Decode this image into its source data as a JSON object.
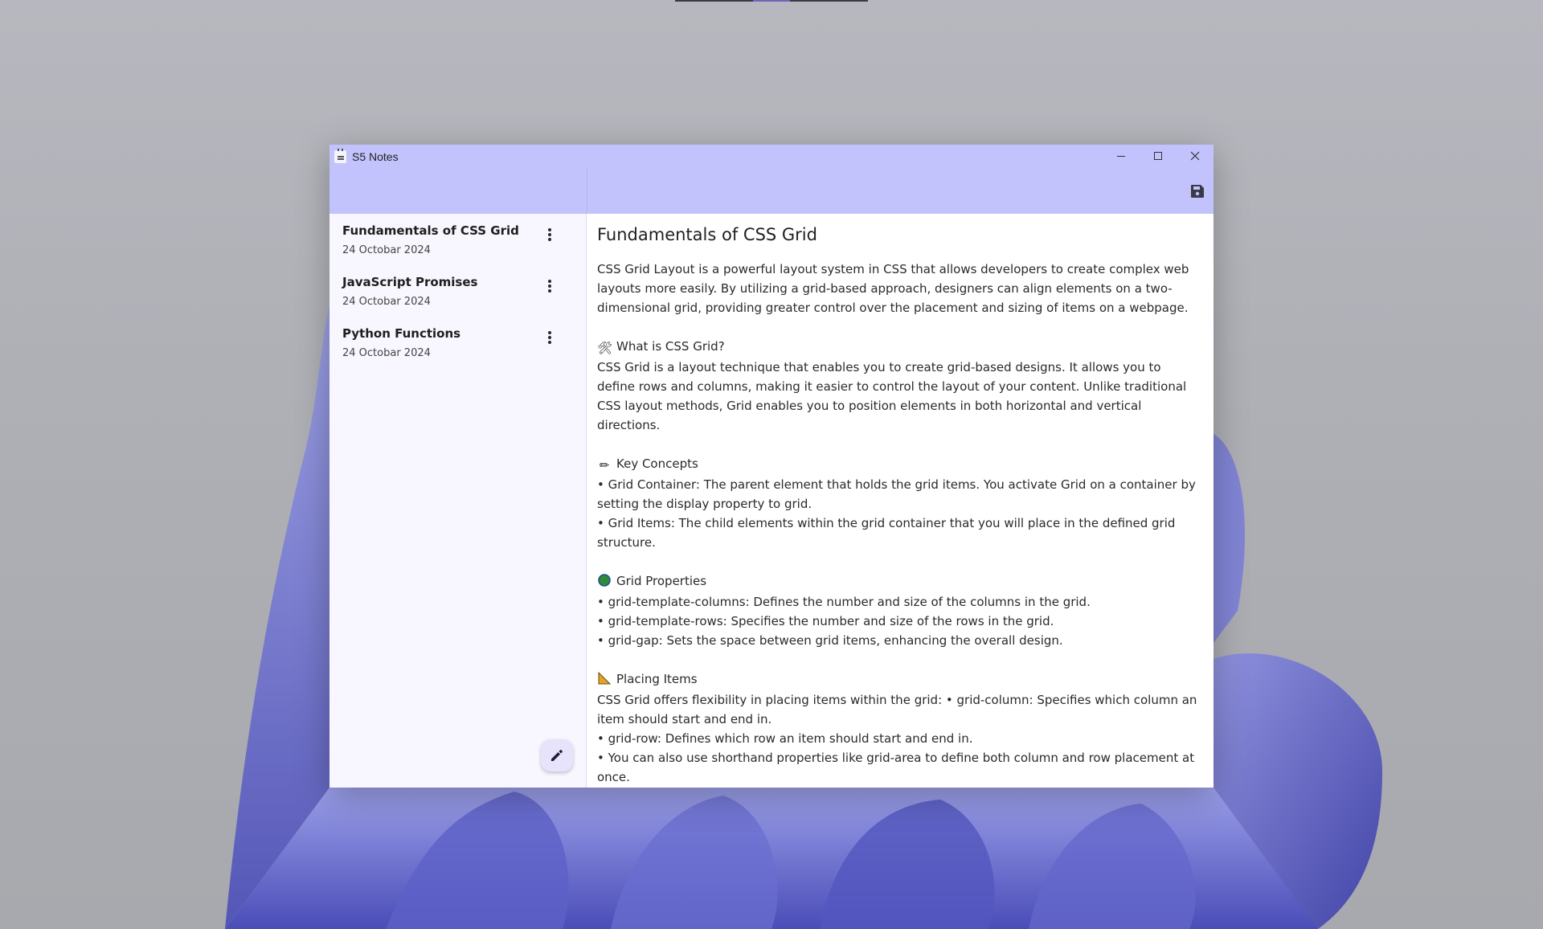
{
  "window": {
    "title": "S5 Notes"
  },
  "titlebar_buttons": {
    "minimize_icon": "minimize-icon",
    "maximize_icon": "maximize-icon",
    "close_icon": "close-icon"
  },
  "toolbar": {
    "save_icon": "save-icon"
  },
  "sidebar": {
    "notes": [
      {
        "title": "Fundamentals of CSS Grid",
        "date": "24 Octobar 2024"
      },
      {
        "title": "JavaScript Promises",
        "date": "24 Octobar 2024"
      },
      {
        "title": "Python Functions",
        "date": "24 Octobar 2024"
      }
    ],
    "new_note_icon": "pencil-icon"
  },
  "note": {
    "title": "Fundamentals of CSS Grid",
    "intro": "CSS Grid Layout is a powerful layout system in CSS that allows developers to create complex web layouts more easily. By utilizing a grid-based approach, designers can align elements on a two-dimensional grid, providing greater control over the placement and sizing of items on a webpage.",
    "section1": {
      "heading": "What is CSS Grid?",
      "text": "CSS Grid is a layout technique that enables you to create grid-based designs. It allows you to define rows and columns, making it easier to control the layout of your content. Unlike traditional CSS layout methods, Grid enables you to position elements in both horizontal and vertical directions."
    },
    "section2": {
      "heading": "Key Concepts",
      "items": [
        "• Grid Container: The parent element that holds the grid items. You activate Grid on a container by setting the display property to grid.",
        "• Grid Items: The child elements within the grid container that you will place in the defined grid structure."
      ]
    },
    "section3": {
      "heading": "Grid Properties",
      "items": [
        "• grid-template-columns: Defines the number and size of the columns in the grid.",
        "• grid-template-rows: Specifies the number and size of the rows in the grid.",
        "• grid-gap: Sets the space between grid items, enhancing the overall design."
      ]
    },
    "section4": {
      "heading": "Placing Items",
      "items": [
        "CSS Grid offers flexibility in placing items within the grid: • grid-column: Specifies which column an item should start and end in.",
        "• grid-row: Defines which row an item should start and end in.",
        "• You can also use shorthand properties like grid-area to define both column and row placement at once."
      ]
    }
  },
  "colors": {
    "titlebar": "#c2c2fd",
    "sidebar": "#f8f6fe",
    "fab": "#e6e3fb"
  }
}
